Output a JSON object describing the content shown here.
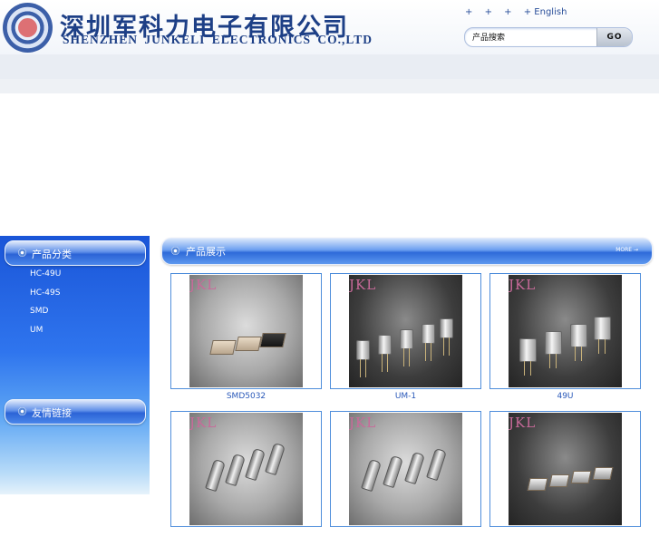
{
  "header": {
    "company_cn": "深圳军科力电子有限公司",
    "company_en": "SHENZHEN JUNKELI ELECTRONICS CO.,LTD",
    "top_links": [
      "+",
      "+",
      "+",
      "+ English"
    ]
  },
  "search": {
    "value": "产品搜索",
    "button": "GO"
  },
  "sidebar": {
    "categories_title": "产品分类",
    "categories": [
      "HC-49U",
      "HC-49S",
      "SMD",
      "UM"
    ],
    "links_title": "友情链接"
  },
  "main": {
    "title": "产品展示",
    "more": "MORE →",
    "products": [
      {
        "name": "SMD5032",
        "watermark": "JKL"
      },
      {
        "name": "UM-1",
        "watermark": "JKL"
      },
      {
        "name": "49U",
        "watermark": "JKL"
      },
      {
        "name": "",
        "watermark": "JKL"
      },
      {
        "name": "",
        "watermark": "JKL"
      },
      {
        "name": "",
        "watermark": "JKL"
      }
    ]
  }
}
